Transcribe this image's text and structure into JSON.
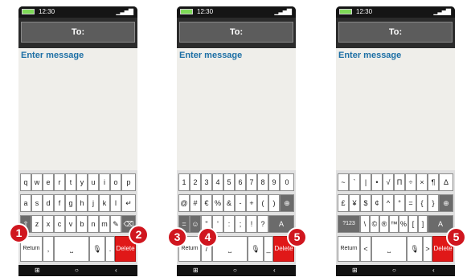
{
  "status": {
    "time": "12:30"
  },
  "to_label": "To:",
  "message_placeholder": "Enter message",
  "nav": {
    "recents": "⊞",
    "home": "○",
    "back": "‹"
  },
  "phones": [
    {
      "rows": [
        [
          "q",
          "w",
          "e",
          "r",
          "t",
          "y",
          "u",
          "i",
          "o",
          "p"
        ],
        [
          "a",
          "s",
          "d",
          "f",
          "g",
          "h",
          "j",
          "k",
          "l",
          "↵"
        ],
        [
          "⇧",
          "z",
          "x",
          "c",
          "v",
          "b",
          "n",
          "m",
          "✎",
          "⌫"
        ]
      ],
      "bottom": {
        "return": "Return",
        "punct": ",",
        "space": "⎵",
        "mic": "🎙",
        "dot": ".",
        "delete": "Delete"
      }
    },
    {
      "rows": [
        [
          "1",
          "2",
          "3",
          "4",
          "5",
          "6",
          "7",
          "8",
          "9",
          "0"
        ],
        [
          "@",
          "#",
          "€",
          "%",
          "&",
          "-",
          "+",
          "(",
          ")",
          "⊕"
        ],
        [
          "=",
          "☺",
          "\"",
          "'",
          ":",
          ";",
          "!",
          "?",
          "A"
        ]
      ],
      "bottom": {
        "return": "Return",
        "punct": "/",
        "space": "⎵",
        "mic": "🎙",
        "dot": "_",
        "delete": "Delete"
      }
    },
    {
      "rows": [
        [
          "~",
          "`",
          "|",
          "•",
          "√",
          "Π",
          "÷",
          "×",
          "¶",
          "Δ"
        ],
        [
          "£",
          "¥",
          "$",
          "¢",
          "^",
          "°",
          "=",
          "{",
          "}",
          "⊕"
        ],
        [
          "?123",
          "\\",
          "©",
          "®",
          "™",
          "%",
          "[",
          "]",
          "A"
        ]
      ],
      "bottom": {
        "return": "Return",
        "punct": "<",
        "space": "⎵",
        "mic": "🎙",
        "dot": ">",
        "delete": "Delete"
      }
    }
  ],
  "badges": [
    "1",
    "2",
    "3",
    "4",
    "5",
    "5"
  ],
  "colors": {
    "accent": "#1d6fa5",
    "delete": "#e01818",
    "badge": "#d0161f"
  }
}
